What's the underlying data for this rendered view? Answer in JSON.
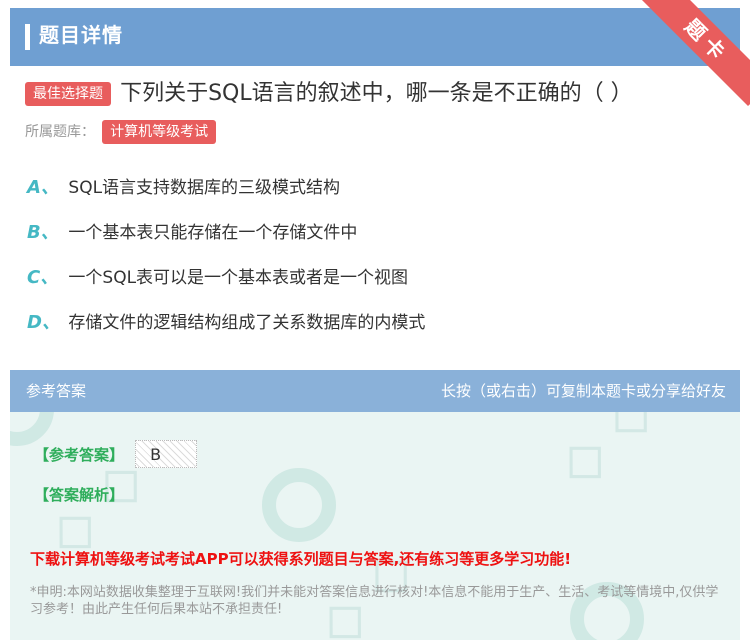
{
  "header": {
    "title": "题目详情",
    "ribbon": "题卡"
  },
  "question": {
    "type_badge": "最佳选择题",
    "text": "下列关于SQL语言的叙述中，哪一条是不正确的（ ）",
    "bank_label": "所属题库：",
    "bank_name": "计算机等级考试"
  },
  "options": [
    {
      "letter": "A、",
      "text": "SQL语言支持数据库的三级模式结构"
    },
    {
      "letter": "B、",
      "text": "一个基本表只能存储在一个存储文件中"
    },
    {
      "letter": "C、",
      "text": "一个SQL表可以是一个基本表或者是一个视图"
    },
    {
      "letter": "D、",
      "text": "存储文件的逻辑结构组成了关系数据库的内模式"
    }
  ],
  "answer_panel": {
    "title": "参考答案",
    "hint": "长按（或右击）可复制本题卡或分享给好友",
    "answer_label": "【参考答案】",
    "answer_value": "B",
    "analysis_label": "【答案解析】",
    "promo": "下载计算机等级考试考试APP可以获得系列题目与答案,还有练习等更多学习功能!",
    "disclaimer": "*申明:本网站数据收集整理于互联网!我们并未能对答案信息进行核对!本信息不能用于生产、生活、考试等情境中,仅供学习参考！由此产生任何后果本站不承担责任!"
  },
  "colors": {
    "header_bg": "#6f9fd2",
    "accent_red": "#e85d5d",
    "option_letter": "#45b8c4",
    "answer_green": "#2fae5c",
    "promo_red": "#ee1111"
  }
}
